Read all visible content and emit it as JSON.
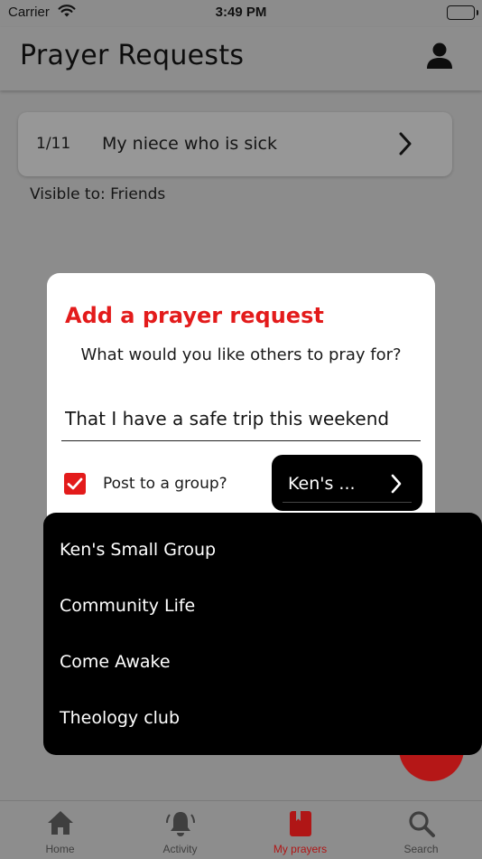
{
  "status_bar": {
    "carrier": "Carrier",
    "time": "3:49 PM"
  },
  "header": {
    "title": "Prayer Requests",
    "profile_icon": "person-icon"
  },
  "prayer_list": {
    "items": [
      {
        "count": "1/11",
        "text": "My niece who is sick"
      }
    ],
    "visibility": "Visible to: Friends"
  },
  "dialog": {
    "title": "Add a prayer request",
    "subtitle": "What would you like others to pray for?",
    "input_value": "That I have a safe trip this weekend",
    "checkbox_checked": true,
    "checkbox_label": "Post to a group?",
    "group_selected": "Ken's ..."
  },
  "group_menu": {
    "options": [
      "Ken's Small Group",
      "Community Life",
      "Come Awake",
      "Theology club"
    ]
  },
  "tab_bar": {
    "tabs": [
      {
        "label": "Home",
        "icon": "home-icon"
      },
      {
        "label": "Activity",
        "icon": "bell-icon"
      },
      {
        "label": "My prayers",
        "icon": "book-icon",
        "active": true
      },
      {
        "label": "Search",
        "icon": "search-icon"
      }
    ]
  },
  "colors": {
    "accent": "#e31b1b",
    "overlay_bg": "#8c8c8c",
    "menu_bg": "#000000"
  }
}
